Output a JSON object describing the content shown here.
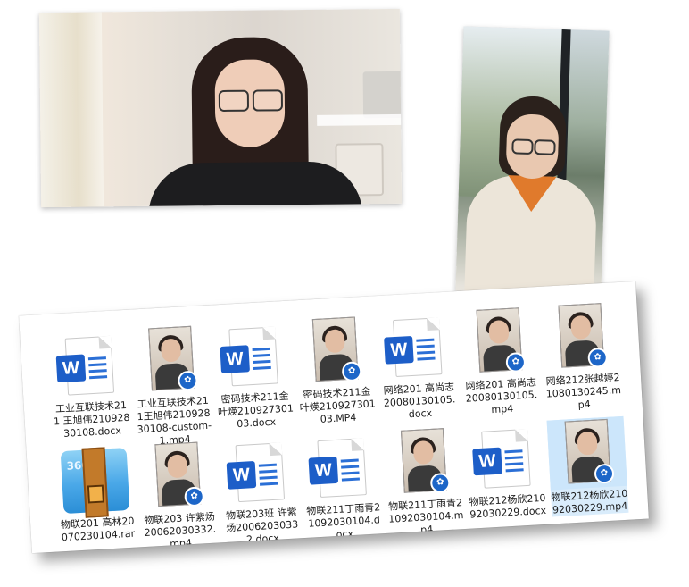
{
  "photos": [
    {
      "description_name": "photo-webcam-1"
    },
    {
      "description_name": "photo-webcam-2"
    }
  ],
  "explorer": {
    "files": [
      {
        "name": "工业互联技术211 王旭伟21092830108.docx",
        "type": "docx"
      },
      {
        "name": "工业互联技术211王旭伟21092830108-custom-1.mp4",
        "type": "mp4"
      },
      {
        "name": "密码技术211金叶煐21092730103.docx",
        "type": "docx"
      },
      {
        "name": "密码技术211金叶煐21092730103.MP4",
        "type": "mp4"
      },
      {
        "name": "网络201 高尚志20080130105.docx",
        "type": "docx"
      },
      {
        "name": "网络201 高尚志20080130105.mp4",
        "type": "mp4"
      },
      {
        "name": "网络212张越婷21080130245.mp4",
        "type": "mp4"
      },
      {
        "name": "物联201 高林20070230104.rar",
        "type": "rar"
      },
      {
        "name": "物联203 许紫炀20062030332.mp4",
        "type": "mp4"
      },
      {
        "name": "物联203班 许紫炀20062030332.docx",
        "type": "docx"
      },
      {
        "name": "物联211丁雨青21092030104.docx",
        "type": "docx"
      },
      {
        "name": "物联211丁雨青21092030104.mp4",
        "type": "mp4"
      },
      {
        "name": "物联212杨欣21092030229.docx",
        "type": "docx"
      },
      {
        "name": "物联212杨欣21092030229.mp4",
        "type": "mp4",
        "selected": true
      }
    ],
    "icons": {
      "docx": "word-document-icon",
      "mp4": "video-file-icon",
      "rar": "archive-360zip-icon"
    },
    "word_badge": "W",
    "zip_badge": "360",
    "accent": "#1d5ec8",
    "selection_color": "#cce6fb"
  }
}
